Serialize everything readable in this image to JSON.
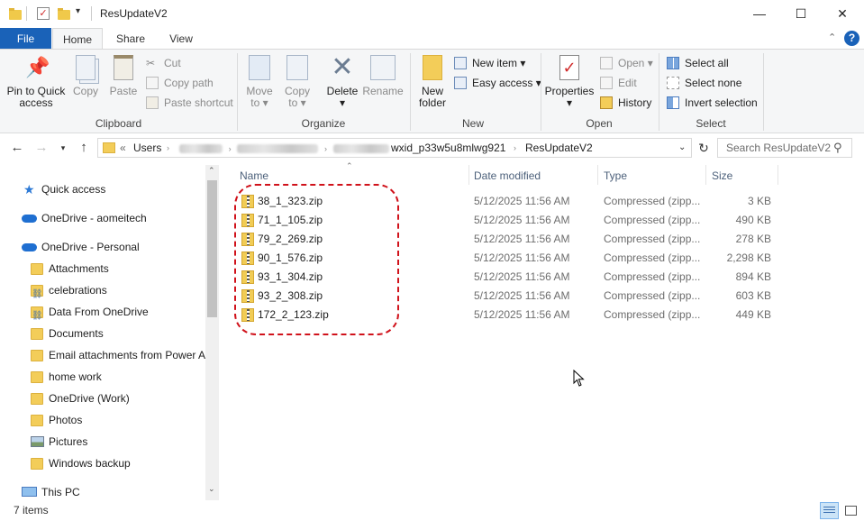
{
  "window": {
    "title": "ResUpdateV2",
    "min_glyph": "—",
    "max_glyph": "☐",
    "close_glyph": "✕"
  },
  "tabs": [
    "File",
    "Home",
    "Share",
    "View"
  ],
  "ribbon": {
    "clipboard": {
      "label": "Clipboard",
      "pin": "Pin to Quick",
      "pin2": "access",
      "copy": "Copy",
      "paste": "Paste",
      "cut": "Cut",
      "copy_path": "Copy path",
      "paste_shortcut": "Paste shortcut"
    },
    "organize": {
      "label": "Organize",
      "move_to": "Move",
      "move_to2": "to",
      "copy_to": "Copy",
      "copy_to2": "to",
      "delete": "Delete",
      "rename": "Rename"
    },
    "new": {
      "label": "New",
      "new_folder": "New",
      "new_folder2": "folder",
      "new_item": "New item",
      "easy_access": "Easy access"
    },
    "open": {
      "label": "Open",
      "properties": "Properties",
      "open": "Open",
      "edit": "Edit",
      "history": "History"
    },
    "select": {
      "label": "Select",
      "select_all": "Select all",
      "select_none": "Select none",
      "invert": "Invert selection"
    }
  },
  "address": {
    "prefix": "«",
    "users": "Users",
    "wxid": "wxid_p33w5u8mlwg921",
    "current": "ResUpdateV2",
    "search_placeholder": "Search ResUpdateV2"
  },
  "nav": {
    "quick_access": "Quick access",
    "onedrive_aomei": "OneDrive - aomeitech",
    "onedrive_personal": "OneDrive - Personal",
    "folders": [
      {
        "label": "Attachments",
        "kind": "yellow"
      },
      {
        "label": "celebrations",
        "kind": "link"
      },
      {
        "label": "Data From OneDrive",
        "kind": "link"
      },
      {
        "label": "Documents",
        "kind": "yellow"
      },
      {
        "label": "Email attachments from Power A",
        "kind": "yellow"
      },
      {
        "label": "home work",
        "kind": "yellow"
      },
      {
        "label": "OneDrive (Work)",
        "kind": "yellow"
      },
      {
        "label": "Photos",
        "kind": "yellow"
      },
      {
        "label": "Pictures",
        "kind": "pictures"
      },
      {
        "label": "Windows backup",
        "kind": "yellow"
      }
    ],
    "this_pc": "This PC"
  },
  "columns": {
    "name": "Name",
    "date": "Date modified",
    "type": "Type",
    "size": "Size"
  },
  "files": [
    {
      "name": "38_1_323.zip",
      "date": "5/12/2025 11:56 AM",
      "type": "Compressed (zipp...",
      "size": "3 KB"
    },
    {
      "name": "71_1_105.zip",
      "date": "5/12/2025 11:56 AM",
      "type": "Compressed (zipp...",
      "size": "490 KB"
    },
    {
      "name": "79_2_269.zip",
      "date": "5/12/2025 11:56 AM",
      "type": "Compressed (zipp...",
      "size": "278 KB"
    },
    {
      "name": "90_1_576.zip",
      "date": "5/12/2025 11:56 AM",
      "type": "Compressed (zipp...",
      "size": "2,298 KB"
    },
    {
      "name": "93_1_304.zip",
      "date": "5/12/2025 11:56 AM",
      "type": "Compressed (zipp...",
      "size": "894 KB"
    },
    {
      "name": "93_2_308.zip",
      "date": "5/12/2025 11:56 AM",
      "type": "Compressed (zipp...",
      "size": "603 KB"
    },
    {
      "name": "172_2_123.zip",
      "date": "5/12/2025 11:56 AM",
      "type": "Compressed (zipp...",
      "size": "449 KB"
    }
  ],
  "status": {
    "items": "7 items"
  },
  "colors": {
    "file_tab": "#1a62b8",
    "highlight_circle": "#d0121b",
    "onedrive": "#1f6fd1"
  }
}
